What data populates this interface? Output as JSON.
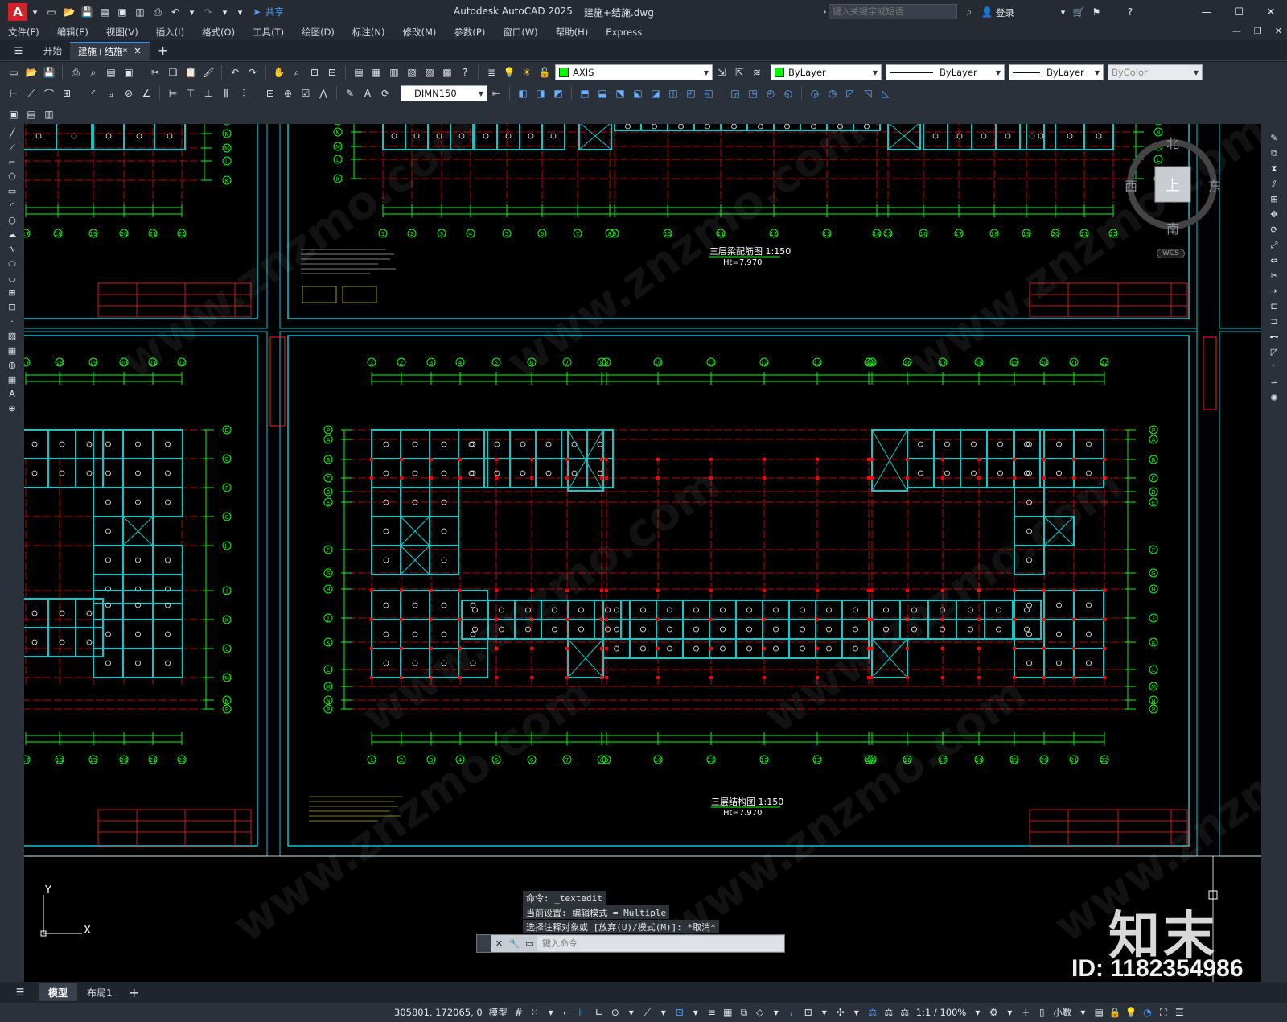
{
  "titlebar": {
    "app_letter": "A",
    "share_label": "共享",
    "title": "Autodesk AutoCAD 2025",
    "filename": "建施+结施.dwg",
    "search_placeholder": "键入关键字或短语",
    "login_label": "登录"
  },
  "menubar": {
    "items": [
      "文件(F)",
      "编辑(E)",
      "视图(V)",
      "插入(I)",
      "格式(O)",
      "工具(T)",
      "绘图(D)",
      "标注(N)",
      "修改(M)",
      "参数(P)",
      "窗口(W)",
      "帮助(H)",
      "Express"
    ]
  },
  "tabs": {
    "items": [
      {
        "label": "开始"
      },
      {
        "label": "建施+结施*"
      }
    ]
  },
  "properties": {
    "layer": "AXIS",
    "color": "ByLayer",
    "linetype": "ByLayer",
    "lineweight": "ByLayer",
    "plotstyle": "ByColor",
    "dimstyle": "DIMN150",
    "layer_color": "#00ff00"
  },
  "viewcube": {
    "north": "北",
    "south": "南",
    "east": "东",
    "west": "西",
    "face": "上",
    "wcs": "WCS"
  },
  "drawing": {
    "sheets": [
      {
        "title": "三层梁配筋图 1:150",
        "elevation": "Ht=7.970"
      },
      {
        "title": "三层结构图  1:150",
        "elevation": "Ht=7.970"
      }
    ],
    "axis_numbers": [
      "1",
      "2",
      "3",
      "4",
      "5",
      "6",
      "7",
      "8",
      "9",
      "10",
      "11",
      "12",
      "13",
      "14",
      "15",
      "16",
      "17",
      "18",
      "19",
      "20",
      "21",
      "22"
    ],
    "axis_letters": [
      "A",
      "B",
      "C",
      "D",
      "E",
      "F",
      "G",
      "H",
      "J",
      "K",
      "L",
      "M",
      "N",
      "P"
    ],
    "ucs_x": "X",
    "ucs_y": "Y"
  },
  "command": {
    "history": [
      "命令: _textedit",
      "当前设置: 编辑模式 = Multiple",
      "选择注释对象或 [放弃(U)/模式(M)]: *取消*"
    ],
    "placeholder": "键入命令"
  },
  "layout_tabs": {
    "items": [
      {
        "label": "模型"
      },
      {
        "label": "布局1"
      }
    ]
  },
  "statusbar": {
    "coords": "305801, 172065, 0",
    "space": "模型",
    "scale": "1:1 / 100%",
    "units": "小数"
  },
  "overlay": {
    "brand": "知末",
    "id_text": "ID: 1182354986"
  },
  "colors": {
    "axis_green": "#00ff00",
    "beam_cyan": "#00cccc",
    "column_red": "#ff0000",
    "frame_cyan": "#00c8d8",
    "titleblock_red": "#ff2020"
  }
}
